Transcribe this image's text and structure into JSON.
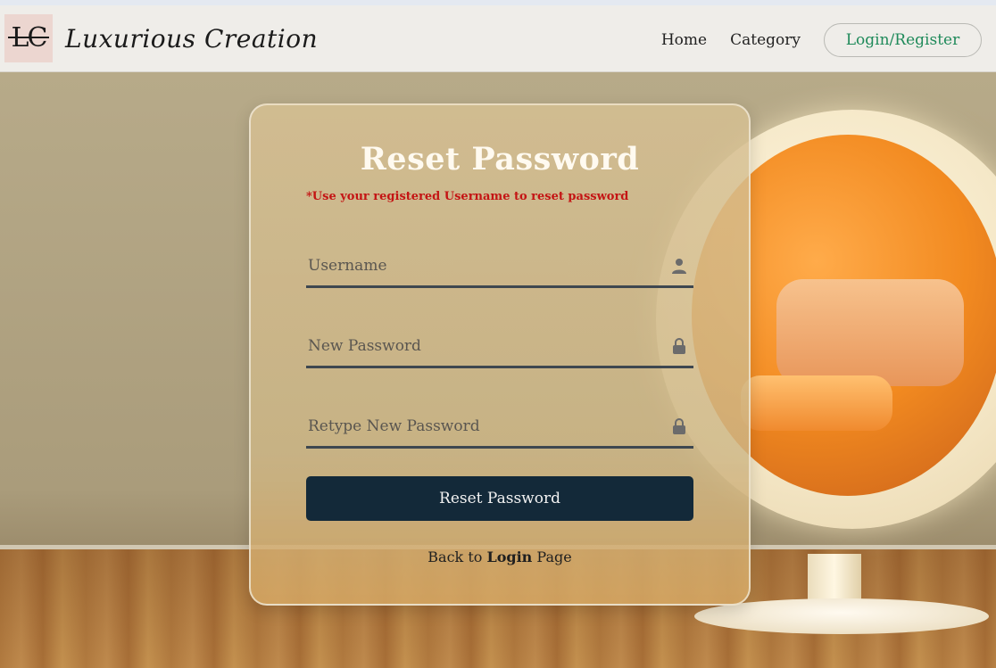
{
  "nav": {
    "logo_letters": "LC",
    "brand": "Luxurious Creation",
    "links": [
      "Home",
      "Category"
    ],
    "auth_button": "Login/Register"
  },
  "form": {
    "title": "Reset Password",
    "hint": "*Use your registered Username to reset password",
    "fields": [
      {
        "placeholder": "Username",
        "icon": "user-icon"
      },
      {
        "placeholder": "New Password",
        "icon": "lock-icon"
      },
      {
        "placeholder": "Retype New Password",
        "icon": "lock-icon"
      }
    ],
    "submit_label": "Reset Password",
    "back_prefix": "Back to",
    "back_link": "Login",
    "back_suffix": "Page"
  },
  "colors": {
    "hint": "#c41414",
    "button": "#132939",
    "auth_link": "#1f8a5a"
  }
}
